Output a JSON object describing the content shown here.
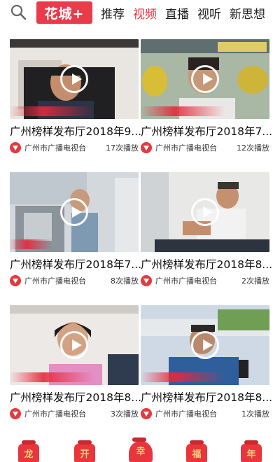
{
  "header": {
    "brand": "花城+",
    "tabs": [
      {
        "label": "推荐",
        "active": false
      },
      {
        "label": "视频",
        "active": true
      },
      {
        "label": "直播",
        "active": false
      },
      {
        "label": "视听",
        "active": false
      },
      {
        "label": "新思想",
        "active": false
      }
    ],
    "accent_color": "#e8323d"
  },
  "videos": [
    {
      "title": "广州榜样发布厅2018年9...",
      "source": "广州市广播电视台",
      "plays": "17次播放"
    },
    {
      "title": "广州榜样发布厅2018年7...",
      "source": "广州市广播电视台",
      "plays": "12次播放"
    },
    {
      "title": "广州榜样发布厅2018年7...",
      "source": "广州市广播电视台",
      "plays": "8次播放"
    },
    {
      "title": "广州榜样发布厅2018年8...",
      "source": "广州市广播电视台",
      "plays": "2次播放"
    },
    {
      "title": "广州榜样发布厅2018年8...",
      "source": "广州市广播电视台",
      "plays": "3次播放"
    },
    {
      "title": "广州榜样发布厅2018年8...",
      "source": "广州市广播电视台",
      "plays": "1次播放"
    }
  ],
  "bottom_nav": {
    "items": [
      {
        "label": "龙"
      },
      {
        "label": "开"
      },
      {
        "label": "幸"
      },
      {
        "label": "福"
      },
      {
        "label": "年"
      }
    ]
  }
}
